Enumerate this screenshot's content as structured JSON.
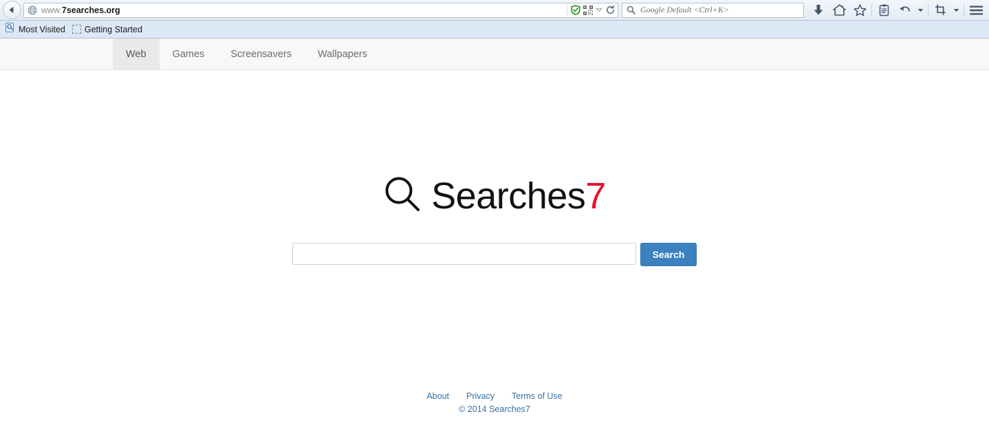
{
  "browser": {
    "back_button": "Back",
    "url": {
      "prefix": "www.",
      "domain": "7searches.org",
      "full": "www.7searches.org"
    },
    "search_field": {
      "placeholder": "Google Default <Ctrl+K>",
      "value": ""
    },
    "urlbar_icons": [
      {
        "name": "shield-icon",
        "label": "Site security"
      },
      {
        "name": "qr-code-icon",
        "label": "QR code"
      },
      {
        "name": "chevron-down-icon",
        "label": "More"
      },
      {
        "name": "reload-icon",
        "label": "Reload"
      }
    ],
    "toolbar_icons": [
      {
        "name": "downloads-icon",
        "label": "Downloads"
      },
      {
        "name": "home-icon",
        "label": "Home"
      },
      {
        "name": "bookmark-star-icon",
        "label": "Bookmarks"
      },
      {
        "name": "reader-icon",
        "label": "Reader"
      },
      {
        "name": "undo-icon",
        "label": "Undo"
      },
      {
        "name": "chevron-down-icon",
        "label": "More"
      },
      {
        "name": "crop-icon",
        "label": "Screenshot"
      },
      {
        "name": "chevron-down-icon",
        "label": "More"
      },
      {
        "name": "menu-icon",
        "label": "Open menu"
      }
    ],
    "bookmarks": [
      {
        "label": "Most Visited",
        "icon": "most-visited-icon"
      },
      {
        "label": "Getting Started",
        "icon": "placeholder-icon"
      }
    ]
  },
  "site": {
    "tabs": [
      {
        "label": "Web",
        "active": true
      },
      {
        "label": "Games",
        "active": false
      },
      {
        "label": "Screensavers",
        "active": false
      },
      {
        "label": "Wallpapers",
        "active": false
      }
    ],
    "logo": {
      "name": "Searches",
      "accent": "7",
      "icon": "magnifier-icon",
      "accent_color": "#e8112d"
    },
    "search": {
      "value": "",
      "placeholder": "",
      "button_label": "Search",
      "button_color": "#3b81bf"
    },
    "footer": {
      "links": [
        {
          "label": "About"
        },
        {
          "label": "Privacy"
        },
        {
          "label": "Terms of Use"
        }
      ],
      "copyright": "© 2014 Searches7",
      "link_color": "#3a6ea5"
    }
  }
}
